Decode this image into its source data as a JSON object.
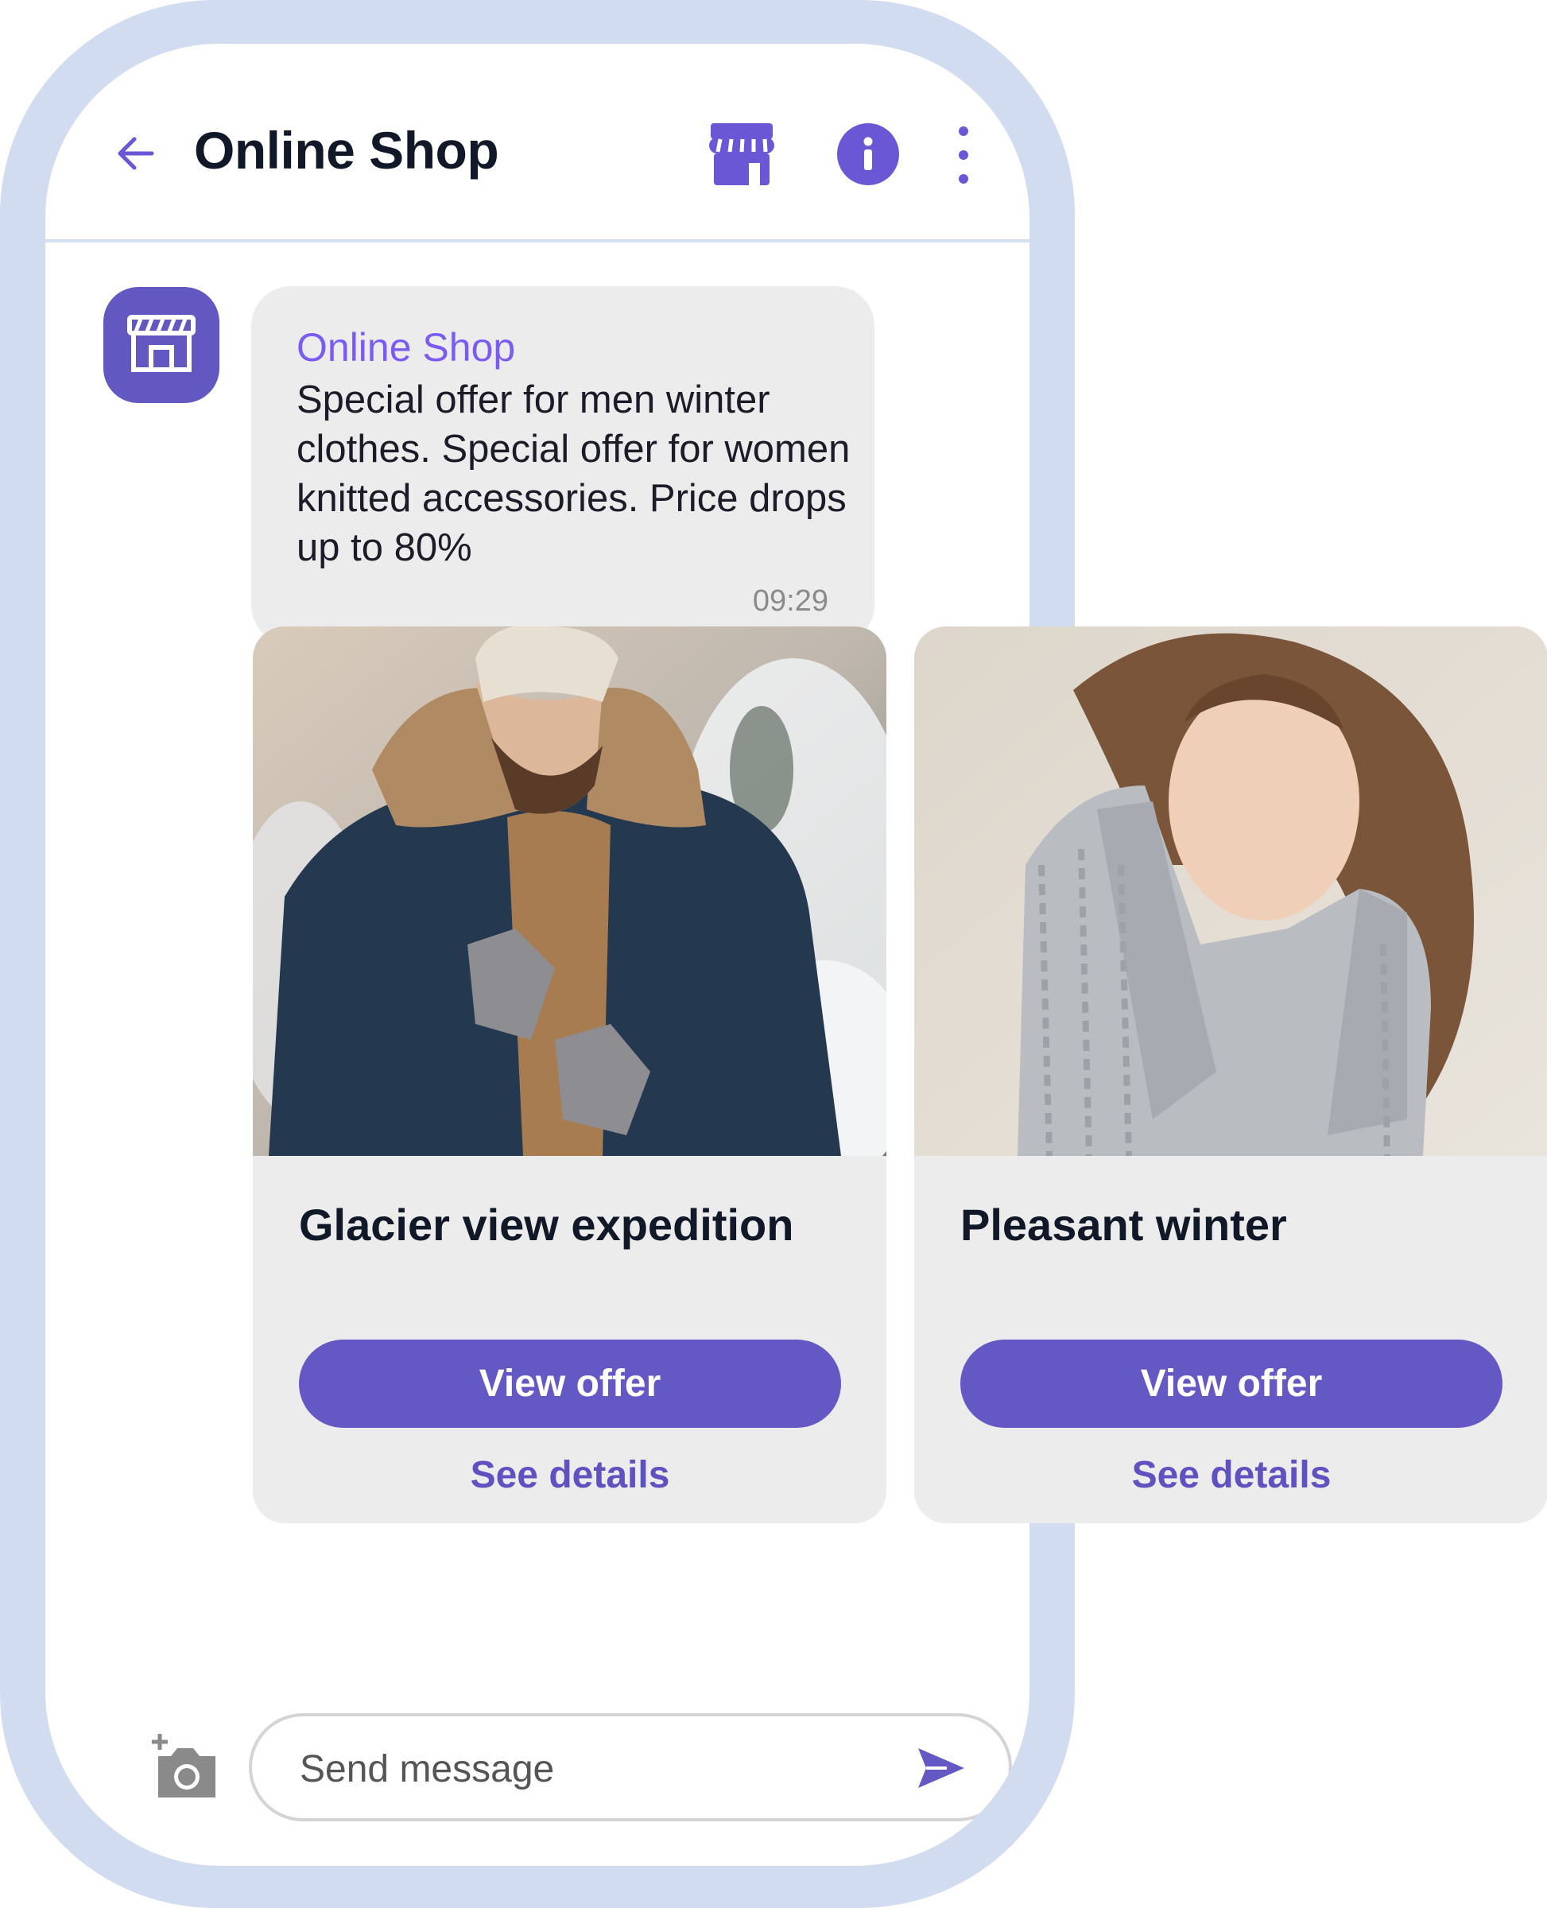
{
  "header": {
    "title": "Online Shop",
    "icons": {
      "back": "arrow-left-icon",
      "store": "storefront-icon",
      "info": "info-icon",
      "more": "more-vertical-icon"
    }
  },
  "message": {
    "avatar_icon": "storefront-icon",
    "sender": "Online Shop",
    "text": "Special offer for men winter clothes. Special offer for women knitted accessories. Price drops up to 80%",
    "time": "09:29"
  },
  "cards": [
    {
      "title": "Glacier view expedition",
      "primary_label": "View offer",
      "secondary_label": "See details"
    },
    {
      "title": "Pleasant winter",
      "primary_label": "View offer",
      "secondary_label": "See details"
    }
  ],
  "composer": {
    "placeholder": "Send message",
    "icons": {
      "attach": "add-photo-camera-icon",
      "send": "send-icon"
    }
  },
  "colors": {
    "accent": "#6458c4",
    "sender_name": "#7b5cf0",
    "frame": "#d2dcf1",
    "bubble": "#ececec"
  }
}
